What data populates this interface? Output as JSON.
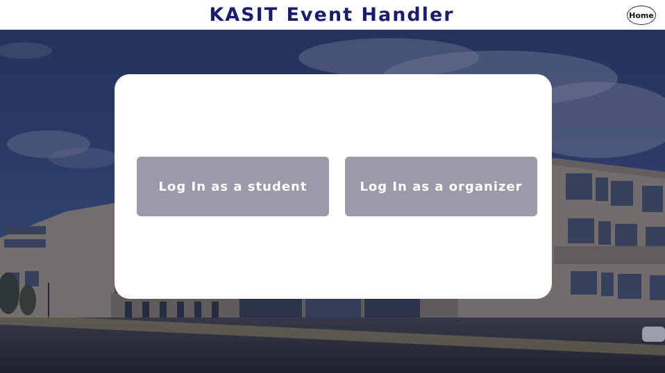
{
  "header": {
    "title": "KASIT Event Handler",
    "home_label": "Home"
  },
  "login": {
    "student_button": "Log In as a student",
    "organizer_button": "Log In as a organizer"
  },
  "colors": {
    "title": "#1c1c6e",
    "button_bg": "#9b9aa8",
    "card_bg": "#ffffff",
    "overlay": "#151a3a"
  }
}
